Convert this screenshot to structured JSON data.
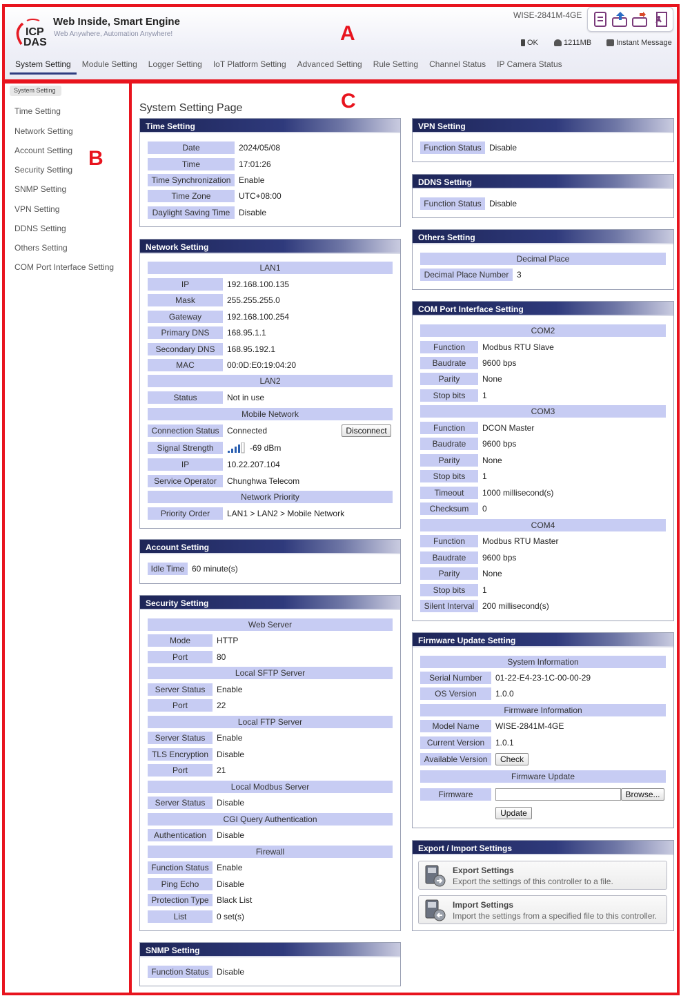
{
  "markers": {
    "a": "A",
    "b": "B",
    "c": "C"
  },
  "brand": {
    "title": "Web Inside, Smart Engine",
    "subtitle": "Web Anywhere, Automation Anywhere!",
    "logo_top": "ICP",
    "logo_bottom": "DAS"
  },
  "device": {
    "model": "WISE-2841M-4GE",
    "status": "OK",
    "memory": "1211MB",
    "instant_message": "Instant Message"
  },
  "topnav": [
    "System Setting",
    "Module Setting",
    "Logger Setting",
    "IoT Platform Setting",
    "Advanced Setting",
    "Rule Setting",
    "Channel Status",
    "IP Camera Status"
  ],
  "sidebar": {
    "crumb": "System Setting",
    "items": [
      "Time Setting",
      "Network Setting",
      "Account Setting",
      "Security Setting",
      "SNMP Setting",
      "VPN Setting",
      "DDNS Setting",
      "Others Setting",
      "COM Port Interface Setting"
    ]
  },
  "page_title": "System Setting Page",
  "time": {
    "title": "Time Setting",
    "date_l": "Date",
    "date": "2024/05/08",
    "time_l": "Time",
    "time": "17:01:26",
    "sync_l": "Time Synchronization",
    "sync": "Enable",
    "zone_l": "Time Zone",
    "zone": "UTC+08:00",
    "dst_l": "Daylight Saving Time",
    "dst": "Disable"
  },
  "network": {
    "title": "Network Setting",
    "lan1": "LAN1",
    "ip_l": "IP",
    "ip": "192.168.100.135",
    "mask_l": "Mask",
    "mask": "255.255.255.0",
    "gw_l": "Gateway",
    "gw": "192.168.100.254",
    "dns1_l": "Primary DNS",
    "dns1": "168.95.1.1",
    "dns2_l": "Secondary DNS",
    "dns2": "168.95.192.1",
    "mac_l": "MAC",
    "mac": "00:0D:E0:19:04:20",
    "lan2": "LAN2",
    "status_l": "Status",
    "status": "Not in use",
    "mobile": "Mobile Network",
    "conn_l": "Connection Status",
    "conn": "Connected",
    "disconnect": "Disconnect",
    "signal_l": "Signal Strength",
    "signal": "-69 dBm",
    "mip_l": "IP",
    "mip": "10.22.207.104",
    "op_l": "Service Operator",
    "op": "Chunghwa Telecom",
    "prio": "Network Priority",
    "prio_l": "Priority Order",
    "prio_v": "LAN1 > LAN2 > Mobile Network"
  },
  "account": {
    "title": "Account Setting",
    "idle_l": "Idle Time",
    "idle": "60 minute(s)"
  },
  "security": {
    "title": "Security Setting",
    "web": "Web Server",
    "mode_l": "Mode",
    "mode": "HTTP",
    "port_l": "Port",
    "port": "80",
    "sftp": "Local SFTP Server",
    "sftp_st_l": "Server Status",
    "sftp_st": "Enable",
    "sftp_port_l": "Port",
    "sftp_port": "22",
    "ftp": "Local FTP Server",
    "ftp_st_l": "Server Status",
    "ftp_st": "Enable",
    "tls_l": "TLS Encryption",
    "tls": "Disable",
    "ftp_port_l": "Port",
    "ftp_port": "21",
    "modbus": "Local Modbus Server",
    "mb_st_l": "Server Status",
    "mb_st": "Disable",
    "cgi": "CGI Query Authentication",
    "auth_l": "Authentication",
    "auth": "Disable",
    "fw": "Firewall",
    "fn_l": "Function Status",
    "fn": "Enable",
    "ping_l": "Ping Echo",
    "ping": "Disable",
    "prot_l": "Protection Type",
    "prot": "Black List",
    "list_l": "List",
    "list": "0 set(s)"
  },
  "snmp": {
    "title": "SNMP Setting",
    "fn_l": "Function Status",
    "fn": "Disable"
  },
  "vpn": {
    "title": "VPN Setting",
    "fn_l": "Function Status",
    "fn": "Disable"
  },
  "ddns": {
    "title": "DDNS Setting",
    "fn_l": "Function Status",
    "fn": "Disable"
  },
  "others": {
    "title": "Others Setting",
    "dp": "Decimal Place",
    "dpn_l": "Decimal Place Number",
    "dpn": "3"
  },
  "com": {
    "title": "COM Port Interface Setting",
    "com2": "COM2",
    "c2_fn_l": "Function",
    "c2_fn": "Modbus RTU Slave",
    "c2_bd_l": "Baudrate",
    "c2_bd": "9600 bps",
    "c2_par_l": "Parity",
    "c2_par": "None",
    "c2_stop_l": "Stop bits",
    "c2_stop": "1",
    "com3": "COM3",
    "c3_fn_l": "Function",
    "c3_fn": "DCON Master",
    "c3_bd_l": "Baudrate",
    "c3_bd": "9600 bps",
    "c3_par_l": "Parity",
    "c3_par": "None",
    "c3_stop_l": "Stop bits",
    "c3_stop": "1",
    "c3_to_l": "Timeout",
    "c3_to": "1000 millisecond(s)",
    "c3_ck_l": "Checksum",
    "c3_ck": "0",
    "com4": "COM4",
    "c4_fn_l": "Function",
    "c4_fn": "Modbus RTU Master",
    "c4_bd_l": "Baudrate",
    "c4_bd": "9600 bps",
    "c4_par_l": "Parity",
    "c4_par": "None",
    "c4_stop_l": "Stop bits",
    "c4_stop": "1",
    "c4_si_l": "Silent Interval",
    "c4_si": "200 millisecond(s)"
  },
  "firmware": {
    "title": "Firmware Update Setting",
    "sysinfo": "System Information",
    "sn_l": "Serial Number",
    "sn": "01-22-E4-23-1C-00-00-29",
    "os_l": "OS Version",
    "os": "1.0.0",
    "fwinfo": "Firmware Information",
    "model_l": "Model Name",
    "model": "WISE-2841M-4GE",
    "cur_l": "Current Version",
    "cur": "1.0.1",
    "avail_l": "Available Version",
    "check": "Check",
    "fwupd": "Firmware Update",
    "fw_l": "Firmware",
    "browse": "Browse...",
    "update": "Update"
  },
  "export": {
    "title": "Export / Import Settings",
    "exp_t": "Export Settings",
    "exp_d": "Export the settings of this controller to a file.",
    "imp_t": "Import Settings",
    "imp_d": "Import the settings from a specified file to this controller."
  }
}
